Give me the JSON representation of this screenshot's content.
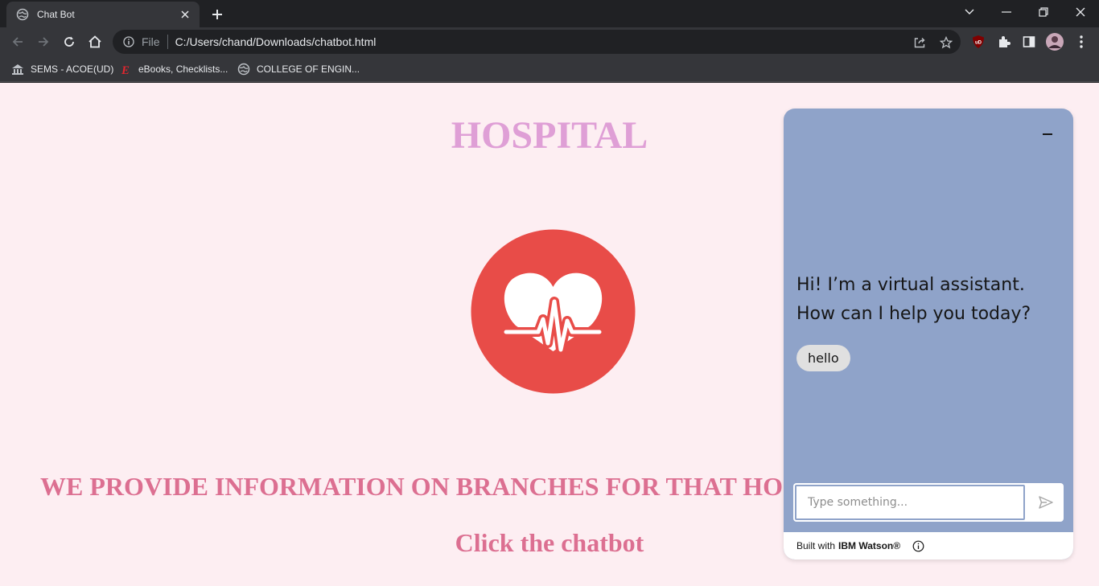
{
  "browser": {
    "tab_title": "Chat Bot",
    "url_scheme": "File",
    "url": "C:/Users/chand/Downloads/chatbot.html",
    "bookmarks": [
      {
        "label": "SEMS - ACOE(UD)",
        "icon": "building-icon"
      },
      {
        "label": "eBooks, Checklists...",
        "icon": "e-logo-icon"
      },
      {
        "label": "COLLEGE OF ENGIN...",
        "icon": "globe-icon"
      }
    ]
  },
  "page": {
    "title": "HOSPITAL",
    "info_text": "WE PROVIDE INFORMATION ON BRANCHES FOR THAT HO",
    "cta_text": "Click the chatbot",
    "logo_icon": "heart-pulse-icon"
  },
  "chat": {
    "greeting": "Hi! I’m a virtual assistant. How can I help you today?",
    "option": "hello",
    "input_placeholder": "Type something...",
    "footer_text": "Built with",
    "footer_brand": "IBM Watson®",
    "panel_color": "#8fa3c9"
  },
  "colors": {
    "page_bg": "#fdeef2",
    "title": "#df9fd6",
    "body_text": "#dc6f91",
    "logo_red": "#e84c48"
  }
}
